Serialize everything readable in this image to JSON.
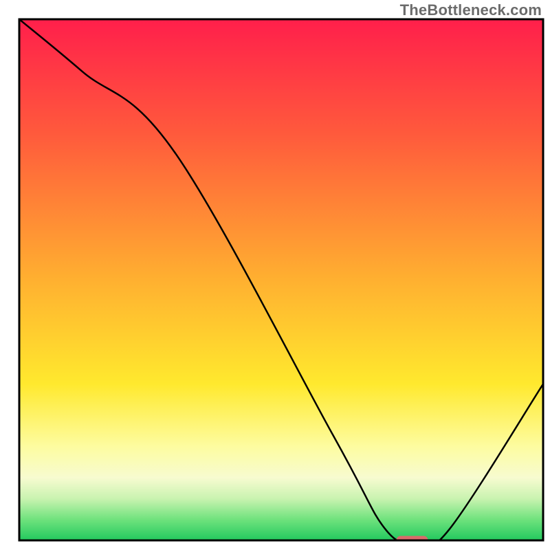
{
  "watermark": "TheBottleneck.com",
  "chart_data": {
    "type": "line",
    "title": "",
    "xlabel": "",
    "ylabel": "",
    "xlim": [
      0,
      100
    ],
    "ylim": [
      0,
      100
    ],
    "grid": false,
    "series": [
      {
        "name": "bottleneck-curve",
        "x": [
          0,
          12,
          30,
          60,
          70,
          76,
          82,
          100
        ],
        "y": [
          100,
          90,
          74,
          20,
          2,
          0,
          2,
          30
        ]
      }
    ],
    "marker": {
      "name": "optimal-segment",
      "x_start": 72,
      "x_end": 78,
      "y": 0,
      "color": "#d86b6b"
    },
    "gradient_stops": [
      {
        "offset": 0,
        "color": "#ff1f4b"
      },
      {
        "offset": 22,
        "color": "#ff5a3c"
      },
      {
        "offset": 50,
        "color": "#ffb030"
      },
      {
        "offset": 70,
        "color": "#ffe92e"
      },
      {
        "offset": 82,
        "color": "#fdfca0"
      },
      {
        "offset": 88,
        "color": "#f7fbd0"
      },
      {
        "offset": 92,
        "color": "#c9f3b0"
      },
      {
        "offset": 96,
        "color": "#6fe27d"
      },
      {
        "offset": 100,
        "color": "#22c95e"
      }
    ],
    "frame_color": "#000000",
    "curve_color": "#000000"
  }
}
